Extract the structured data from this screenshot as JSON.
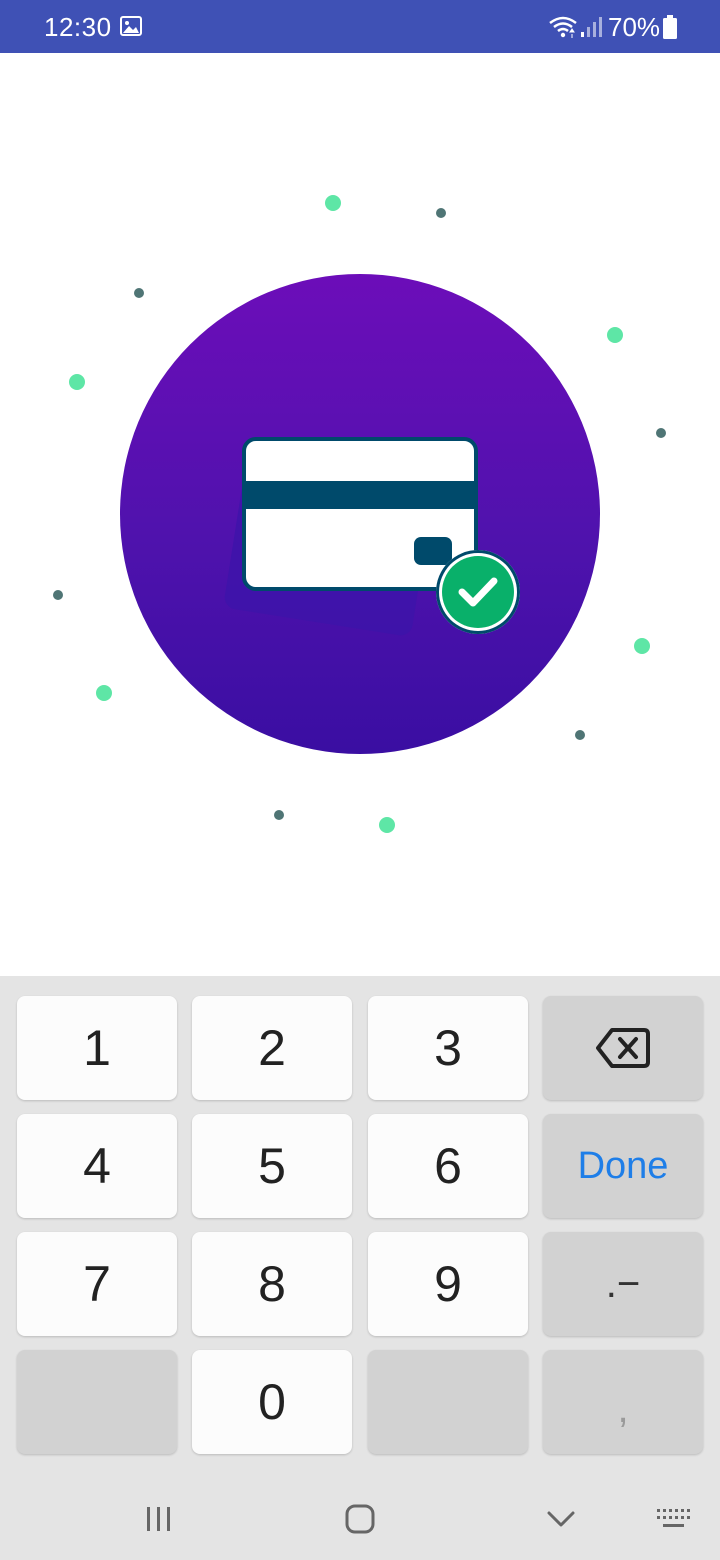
{
  "status_bar": {
    "time": "12:30",
    "battery_percent": "70%",
    "icons": [
      "gallery-icon",
      "wifi-icon",
      "signal-icon",
      "battery-icon"
    ],
    "background_color": "#3f51b5"
  },
  "illustration": {
    "icon": "credit-card-check-icon",
    "circle_gradient": [
      "#6c0db9",
      "#3a0ea2"
    ],
    "accent_color": "#5ee6a6",
    "check_color": "#09b06a"
  },
  "keyboard": {
    "keys": {
      "k1": "1",
      "k2": "2",
      "k3": "3",
      "k4": "4",
      "k5": "5",
      "k6": "6",
      "k7": "7",
      "k8": "8",
      "k9": "9",
      "k0": "0",
      "done": "Done",
      "dot_minus": ".−",
      "comma": ","
    },
    "backspace_icon": "backspace-icon"
  },
  "nav_bar": {
    "buttons": [
      "recent-apps-icon",
      "home-icon",
      "back-icon",
      "keyboard-switch-icon"
    ]
  }
}
